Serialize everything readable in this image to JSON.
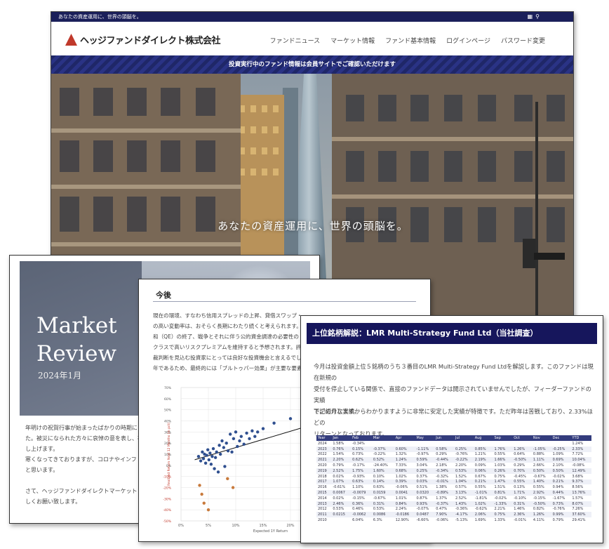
{
  "site": {
    "top_tagline": "あなたの資産運用に、世界の頭脳を。",
    "logo": "ヘッジファンドダイレクト株式会社",
    "nav": [
      "ファンドニュース",
      "マーケット情報",
      "ファンド基本情報",
      "ログインページ",
      "パスワード変更"
    ],
    "banner": "投資実行中のファンド情報は会員サイトでご確認いただけます",
    "hero_tagline": "あなたの資産運用に、世界の頭脳を。"
  },
  "review": {
    "title_line1": "Market",
    "title_line2": "Review",
    "subtitle": "2024年1月",
    "body": [
      "年明けの祝賀行事が始まったばかりの時期に",
      "た。被災になられた方々に哀悼の意を表し、被",
      "し上げます。",
      "寒くなってきておりますが、コロナやインフ",
      "と思います。",
      "",
      "さて、ヘッジファンドダイレクトマーケット",
      "しくお願い致します。"
    ]
  },
  "outlook": {
    "title": "今後",
    "body": [
      "現在の環境、すなわち信用スプレッドの上昇、貸借スワップ・",
      "の高い変動率は、おそらく長期にわたり続くと考えられます。",
      "和（QE）の終了、戦争とそれに伴う公的資金調達の必要性の",
      "クラスで高いリスクプレミアムを維持すると予想されます。評",
      "裁判断を見込む投資家にとっては良好な投資機会と言えるでし",
      "年であるため、最終的には「ブルトゥパー効果」が主要な要素"
    ]
  },
  "chart_data": {
    "type": "scatter",
    "title": "",
    "xlabel": "Expected 1Y Return",
    "ylabel": "Realized Return Next 12 Months (in pct)",
    "x_ticks": [
      "0%",
      "5%",
      "10%",
      "15%",
      "20%",
      "25%"
    ],
    "y_ticks": [
      "70%",
      "60%",
      "50%",
      "40%",
      "30%",
      "20%",
      "10%",
      "0%",
      "-10%",
      "-20%",
      "-30%",
      "-40%",
      "-50%"
    ],
    "xlim": [
      0,
      25
    ],
    "ylim": [
      -50,
      70
    ],
    "series": [
      {
        "color": "#2f4f8f",
        "points": [
          [
            3.2,
            8
          ],
          [
            3.6,
            4
          ],
          [
            3.9,
            12
          ],
          [
            4.1,
            6
          ],
          [
            4.3,
            10
          ],
          [
            4.5,
            2
          ],
          [
            4.7,
            9
          ],
          [
            4.9,
            14
          ],
          [
            5.1,
            5
          ],
          [
            5.3,
            11
          ],
          [
            5.5,
            1
          ],
          [
            5.7,
            8
          ],
          [
            5.9,
            15
          ],
          [
            6.1,
            -3
          ],
          [
            6.3,
            7
          ],
          [
            6.5,
            12
          ],
          [
            6.8,
            -6
          ],
          [
            7,
            18
          ],
          [
            7.2,
            10
          ],
          [
            7.5,
            22
          ],
          [
            7.8,
            16
          ],
          [
            8,
            -1
          ],
          [
            8.3,
            20
          ],
          [
            8.6,
            13
          ],
          [
            9,
            28
          ],
          [
            9.3,
            12
          ],
          [
            9.6,
            24
          ],
          [
            10,
            30
          ],
          [
            10.3,
            17
          ],
          [
            10.7,
            22
          ],
          [
            11,
            26
          ],
          [
            11.5,
            19
          ],
          [
            12,
            29
          ],
          [
            12.5,
            24
          ],
          [
            13,
            31
          ],
          [
            13.5,
            26
          ],
          [
            14,
            30
          ],
          [
            15,
            33
          ],
          [
            17,
            38
          ],
          [
            20,
            42
          ]
        ]
      },
      {
        "color": "#c87a3c",
        "points": [
          [
            3.4,
            -18
          ],
          [
            3.8,
            -26
          ],
          [
            4.2,
            -34
          ],
          [
            5,
            -40
          ],
          [
            8.5,
            -12
          ],
          [
            9.5,
            -20
          ]
        ]
      }
    ],
    "trendline": [
      [
        2.5,
        5
      ],
      [
        25,
        38
      ]
    ]
  },
  "lmr": {
    "title": "上位銘柄解説：LMR Multi-Strategy Fund Ltd（当社調査）",
    "p1": [
      "今月は投資金額上位５銘柄のうち３番目のLMR Multi-Strategy Fund Ltdを解説します。このファンドは現在新規の",
      "受付を停止している関係で、直接のファンドデータは開示されていませんでしたが、フィーダーファンドの実績",
      "でご紹介します。"
    ],
    "p2": [
      "下記の月次実績からわかりますように非常に安定した実績が特徴です。ただ昨年は苦戦しており、2.33%ほどの",
      "リターンとなっております。"
    ],
    "table": {
      "headers": [
        "Year",
        "Jan",
        "Feb",
        "Mar",
        "Apr",
        "May",
        "Jun",
        "Jul",
        "Aug",
        "Sep",
        "Oct",
        "Nov",
        "Dec",
        "YTD"
      ],
      "rows": [
        [
          "2024",
          "1.58%",
          "-0.34%",
          "",
          "",
          "",
          "",
          "",
          "",
          "",
          "",
          "",
          "",
          "1.24%"
        ],
        [
          "2023",
          "0.76%",
          "0.15%",
          "-0.37%",
          "0.60%",
          "-1.11%",
          "0.58%",
          "0.25%",
          "0.85%",
          "1.76%",
          "1.26%",
          "-1.05%",
          "-0.25%",
          "2.33%"
        ],
        [
          "2022",
          "1.54%",
          "0.73%",
          "-0.22%",
          "1.32%",
          "-0.97%",
          "0.29%",
          "-0.76%",
          "1.21%",
          "0.55%",
          "0.64%",
          "0.88%",
          "1.09%",
          "7.72%"
        ],
        [
          "2021",
          "2.20%",
          "0.62%",
          "0.52%",
          "1.24%",
          "0.59%",
          "-0.44%",
          "-0.22%",
          "2.19%",
          "1.66%",
          "-0.50%",
          "1.11%",
          "0.69%",
          "10.04%"
        ],
        [
          "2020",
          "0.79%",
          "-0.17%",
          "-24.40%",
          "7.33%",
          "3.04%",
          "2.18%",
          "2.20%",
          "0.09%",
          "1.03%",
          "0.29%",
          "2.66%",
          "2.10%",
          "-0.08%"
        ],
        [
          "2019",
          "2.52%",
          "1.75%",
          "1.60%",
          "0.68%",
          "0.25%",
          "-0.34%",
          "0.53%",
          "0.06%",
          "0.26%",
          "0.70%",
          "0.50%",
          "0.50%",
          "12.49%"
        ],
        [
          "2018",
          "0.02%",
          "-0.93%",
          "0.10%",
          "1.02%",
          "0.37%",
          "-0.32%",
          "1.52%",
          "0.67%",
          "0.75%",
          "-0.45%",
          "-0.67%",
          "-0.02%",
          "3.68%"
        ],
        [
          "2017",
          "1.07%",
          "0.63%",
          "0.14%",
          "0.39%",
          "0.03%",
          "-0.01%",
          "1.04%",
          "0.21%",
          "1.47%",
          "0.55%",
          "1.40%",
          "0.21%",
          "9.37%"
        ],
        [
          "2016",
          "-0.61%",
          "1.10%",
          "0.63%",
          "-0.06%",
          "0.51%",
          "1.38%",
          "0.57%",
          "0.55%",
          "1.51%",
          "0.13%",
          "0.55%",
          "0.94%",
          "8.56%"
        ],
        [
          "2015",
          "0.0067",
          "-0.0079",
          "0.0159",
          "0.0041",
          "0.0320",
          "-0.89%",
          "3.13%",
          "-1.01%",
          "0.81%",
          "1.71%",
          "2.92%",
          "0.44%",
          "13.76%"
        ],
        [
          "2014",
          "0.02%",
          "-0.15%",
          "-0.67%",
          "1.01%",
          "0.87%",
          "1.37%",
          "2.52%",
          "-1.81%",
          "-0.02%",
          "-0.10%",
          "-0.15%",
          "-1.67%",
          "1.57%"
        ],
        [
          "2013",
          "2.46%",
          "0.36%",
          "0.31%",
          "0.84%",
          "0.93%",
          "-0.37%",
          "1.43%",
          "1.02%",
          "-1.33%",
          "0.31%",
          "-0.50%",
          "0.73%",
          "8.07%"
        ],
        [
          "2012",
          "0.53%",
          "0.46%",
          "0.53%",
          "2.24%",
          "-0.07%",
          "0.47%",
          "-0.36%",
          "-0.62%",
          "2.21%",
          "1.46%",
          "0.82%",
          "-0.76%",
          "7.26%"
        ],
        [
          "2011",
          "0.0215",
          "-0.0062",
          "0.0086",
          "-0.0186",
          "0.0487",
          "7.90%",
          "-4.17%",
          "2.06%",
          "0.75%",
          "2.36%",
          "1.26%",
          "0.99%",
          "37.60%"
        ],
        [
          "2010",
          "",
          "6.04%",
          "6.3%",
          "12.90%",
          "-6.60%",
          "-0.06%",
          "-5.13%",
          "1.69%",
          "1.33%",
          "-0.01%",
          "4.11%",
          "0.79%",
          "29.41%"
        ]
      ]
    }
  }
}
